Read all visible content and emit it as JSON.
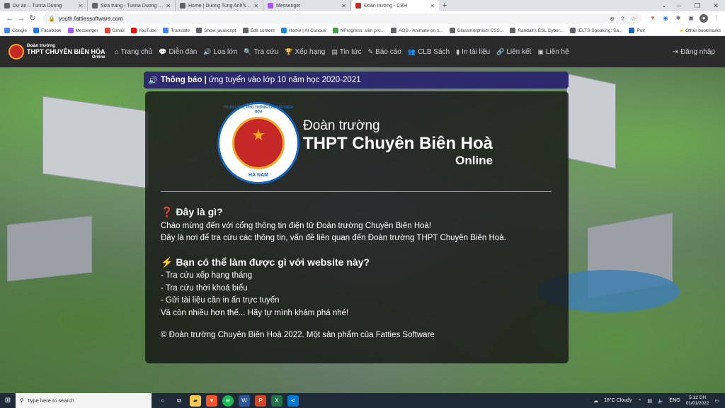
{
  "browser": {
    "tabs": [
      {
        "title": "Dự án – Turina Duong",
        "color": "#5f6368",
        "active": false
      },
      {
        "title": "Sửa trang ‹ Turina Duong — WordPress",
        "color": "#5f6368",
        "active": false
      },
      {
        "title": "Home | Duong Tung Anh's Blog",
        "color": "#5f6368",
        "active": false
      },
      {
        "title": "Messenger",
        "color": "#a855f7",
        "active": false
      },
      {
        "title": "Đoàn trường - CBH",
        "color": "#c62828",
        "active": true
      }
    ],
    "new_tab": "+",
    "url": "youth.fattiessoftware.com",
    "bookmarks": [
      {
        "label": "Google",
        "color": "#4285f4"
      },
      {
        "label": "Facebook",
        "color": "#1877f2"
      },
      {
        "label": "Messenger",
        "color": "#a855f7"
      },
      {
        "label": "Gmail",
        "color": "#ea4335"
      },
      {
        "label": "YouTube",
        "color": "#ff0000"
      },
      {
        "label": "Translate",
        "color": "#4285f4"
      },
      {
        "label": "Show javascript",
        "color": "#5f6368"
      },
      {
        "label": "Edit content",
        "color": "#5f6368"
      },
      {
        "label": "Home | AI Curious",
        "color": "#1e88e5"
      },
      {
        "label": "NProgress: slim pro...",
        "color": "#43a047"
      },
      {
        "label": "AOS - Animate on s...",
        "color": "#5f6368"
      },
      {
        "label": "Glassmorphism CSS...",
        "color": "#5f6368"
      },
      {
        "label": "Randall's ESL Cyber...",
        "color": "#5f6368"
      },
      {
        "label": "IELTS Speaking: Sa...",
        "color": "#5f6368"
      },
      {
        "label": "Polr",
        "color": "#1565c0"
      }
    ],
    "other_bookmarks": "Other bookmarks"
  },
  "site": {
    "brand": {
      "line1": "Đoàn trường",
      "line2": "THPT CHUYÊN BIÊN HÒA",
      "line3": "Online"
    },
    "menu": [
      {
        "label": "Trang chủ",
        "icon": "⌂"
      },
      {
        "label": "Diễn đàn",
        "icon": "💬"
      },
      {
        "label": "Loa lớn",
        "icon": "🔊"
      },
      {
        "label": "Tra cứu",
        "icon": "🔍"
      },
      {
        "label": "Xếp hạng",
        "icon": "🏆"
      },
      {
        "label": "Tin tức",
        "icon": "▤"
      },
      {
        "label": "Báo cáo",
        "icon": "✎"
      },
      {
        "label": "CLB Sách",
        "icon": "👥"
      },
      {
        "label": "In tài liệu",
        "icon": "▮"
      },
      {
        "label": "Liên kết",
        "icon": "🔗"
      },
      {
        "label": "Liên hệ",
        "icon": "▣"
      }
    ],
    "login": "Đăng nhập",
    "notice": {
      "label": "Thông báo |",
      "text": "ứng tuyển vào lớp 10 năm học 2020-2021"
    },
    "hero": {
      "seal_ring": "TRUNG HỌC PHỔ THÔNG CHUYÊN BIÊN HÒA",
      "seal_bottom": "HÀ NAM",
      "title1": "Đoàn trường",
      "title2": "THPT Chuyên Biên Hoà",
      "title3": "Online"
    },
    "about": {
      "heading": "Đây là gì?",
      "lines": [
        "Chào mừng đến với cổng thông tin điện tử Đoàn trường Chuyên Biên Hoà!",
        "Đây là nơi để tra cứu các thông tin, vấn đề liên quan đến Đoàn trường THPT Chuyên Biên Hoà."
      ]
    },
    "features": {
      "heading": "Bạn có thể làm được gì với website này?",
      "lines": [
        "- Tra cứu xếp hạng tháng",
        "- Tra cứu thời khoá biểu",
        "- Gửi tài liệu cần in ấn trực tuyến",
        "Và còn nhiều hơn thế... Hãy tự mình khám phá nhé!"
      ]
    },
    "copyright": "© Đoàn trường Chuyên Biên Hoà 2022. Một sản phẩm của Fatties Software"
  },
  "taskbar": {
    "search_placeholder": "Type here to search",
    "weather": "18°C  Cloudy",
    "lang": "ENG",
    "time": "5:12 CH",
    "date": "01/01/2022"
  }
}
